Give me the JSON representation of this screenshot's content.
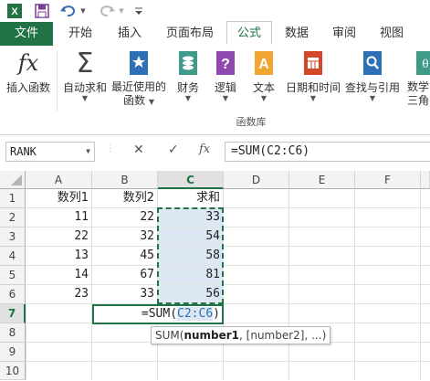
{
  "qat": {
    "icons": [
      "excel-logo-icon",
      "save-icon",
      "undo-icon",
      "redo-icon",
      "customize-qat-icon"
    ]
  },
  "tabs": [
    {
      "label": "文件",
      "type": "file"
    },
    {
      "label": "开始"
    },
    {
      "label": "插入"
    },
    {
      "label": "页面布局"
    },
    {
      "label": "公式",
      "active": true
    },
    {
      "label": "数据"
    },
    {
      "label": "审阅"
    },
    {
      "label": "视图"
    }
  ],
  "ribbon": {
    "insert_function": "插入函数",
    "autosum": "自动求和",
    "recent_line1": "最近使用的",
    "recent_line2": "函数",
    "financial": "财务",
    "logical": "逻辑",
    "text": "文本",
    "datetime": "日期和时间",
    "lookup": "查找与引用",
    "math_line1": "数学",
    "math_line2": "三角函",
    "group_label": "函数库"
  },
  "formula_bar": {
    "name_box": "RANK",
    "cancel_glyph": "✕",
    "enter_glyph": "✓",
    "fx_label": "fx",
    "formula": "=SUM(C2:C6)"
  },
  "grid": {
    "columns": [
      "A",
      "B",
      "C",
      "D",
      "E",
      "F"
    ],
    "rows": [
      "1",
      "2",
      "3",
      "4",
      "5",
      "6",
      "7",
      "8",
      "9",
      "10"
    ],
    "cells": {
      "A1": "数列1",
      "B1": "数列2",
      "C1": "求和",
      "A2": "11",
      "B2": "22",
      "C2": "33",
      "A3": "22",
      "B3": "32",
      "C3": "54",
      "A4": "13",
      "B4": "45",
      "C4": "58",
      "A5": "14",
      "B5": "67",
      "C5": "81",
      "A6": "23",
      "B6": "33",
      "C6": "56",
      "B7_prefix": "=SUM(",
      "B7_range": "C2:C6",
      "B7_suffix": ")"
    },
    "tooltip": {
      "fn": "SUM(",
      "bold_arg": "number1",
      "rest": ", [number2], ...)"
    }
  },
  "colors": {
    "excel_green": "#217346",
    "range_blue": "#2e6fb5",
    "range_fill": "#dde8f4"
  }
}
